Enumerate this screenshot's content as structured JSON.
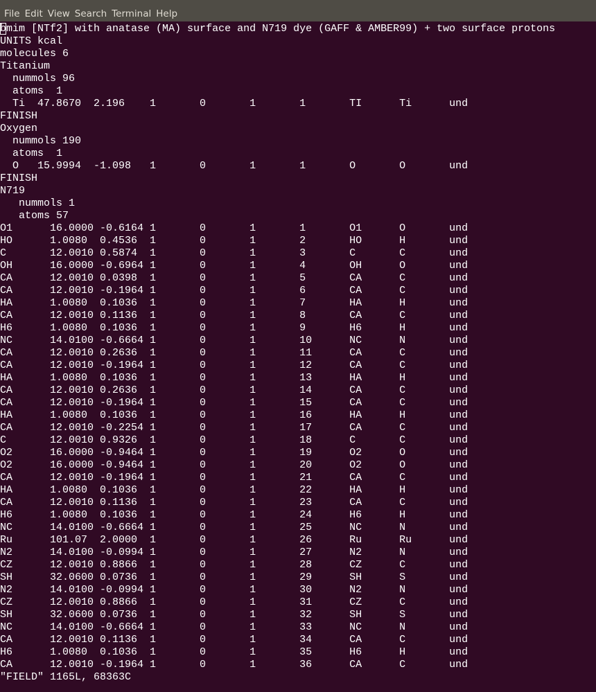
{
  "menu": [
    "File",
    "Edit",
    "View",
    "Search",
    "Terminal",
    "Help"
  ],
  "cursor_char": "b",
  "lines": [
    "mim [NTf2] with anatase (MA) surface and N719 dye (GAFF & AMBER99) + two surface protons",
    "UNITS kcal",
    "molecules 6",
    "Titanium",
    "  nummols 96",
    "  atoms  1",
    "  Ti  47.8670  2.196\t1\t0\t1\t1\tTI\tTi\tund",
    "FINISH",
    "Oxygen",
    "  nummols 190",
    "  atoms  1",
    "  O   15.9994  -1.098\t1\t0\t1\t1\tO\tO\tund",
    "FINISH",
    "N719",
    "   nummols 1",
    "   atoms 57",
    "O1\t16.0000 -0.6164 1\t0\t1\t1\tO1\tO\tund",
    "HO\t1.0080  0.4536  1\t0\t1\t2\tHO\tH\tund",
    "C\t12.0010 0.5874  1\t0\t1\t3\tC\tC\tund",
    "OH\t16.0000 -0.6964 1\t0\t1\t4\tOH\tO\tund",
    "CA\t12.0010 0.0398  1\t0\t1\t5\tCA\tC\tund",
    "CA\t12.0010 -0.1964 1\t0\t1\t6\tCA\tC\tund",
    "HA\t1.0080  0.1036  1\t0\t1\t7\tHA\tH\tund",
    "CA\t12.0010 0.1136  1\t0\t1\t8\tCA\tC\tund",
    "H6\t1.0080  0.1036  1\t0\t1\t9\tH6\tH\tund",
    "NC\t14.0100 -0.6664 1\t0\t1\t10\tNC\tN\tund",
    "CA\t12.0010 0.2636  1\t0\t1\t11\tCA\tC\tund",
    "CA\t12.0010 -0.1964 1\t0\t1\t12\tCA\tC\tund",
    "HA\t1.0080  0.1036  1\t0\t1\t13\tHA\tH\tund",
    "CA\t12.0010 0.2636  1\t0\t1\t14\tCA\tC\tund",
    "CA\t12.0010 -0.1964 1\t0\t1\t15\tCA\tC\tund",
    "HA\t1.0080  0.1036  1\t0\t1\t16\tHA\tH\tund",
    "CA\t12.0010 -0.2254 1\t0\t1\t17\tCA\tC\tund",
    "C\t12.0010 0.9326  1\t0\t1\t18\tC\tC\tund",
    "O2\t16.0000 -0.9464 1\t0\t1\t19\tO2\tO\tund",
    "O2\t16.0000 -0.9464 1\t0\t1\t20\tO2\tO\tund",
    "CA\t12.0010 -0.1964 1\t0\t1\t21\tCA\tC\tund",
    "HA\t1.0080  0.1036  1\t0\t1\t22\tHA\tH\tund",
    "CA\t12.0010 0.1136  1\t0\t1\t23\tCA\tC\tund",
    "H6\t1.0080  0.1036  1\t0\t1\t24\tH6\tH\tund",
    "NC\t14.0100 -0.6664 1\t0\t1\t25\tNC\tN\tund",
    "Ru\t101.07  2.0000  1\t0\t1\t26\tRu\tRu\tund",
    "N2\t14.0100 -0.0994 1\t0\t1\t27\tN2\tN\tund",
    "CZ\t12.0010 0.8866  1\t0\t1\t28\tCZ\tC\tund",
    "SH\t32.0600 0.0736  1\t0\t1\t29\tSH\tS\tund",
    "N2\t14.0100 -0.0994 1\t0\t1\t30\tN2\tN\tund",
    "CZ\t12.0010 0.8866  1\t0\t1\t31\tCZ\tC\tund",
    "SH\t32.0600 0.0736  1\t0\t1\t32\tSH\tS\tund",
    "NC\t14.0100 -0.6664 1\t0\t1\t33\tNC\tN\tund",
    "CA\t12.0010 0.1136  1\t0\t1\t34\tCA\tC\tund",
    "H6\t1.0080  0.1036  1\t0\t1\t35\tH6\tH\tund",
    "CA\t12.0010 -0.1964 1\t0\t1\t36\tCA\tC\tund"
  ],
  "status_line": "\"FIELD\" 1165L, 68363C"
}
